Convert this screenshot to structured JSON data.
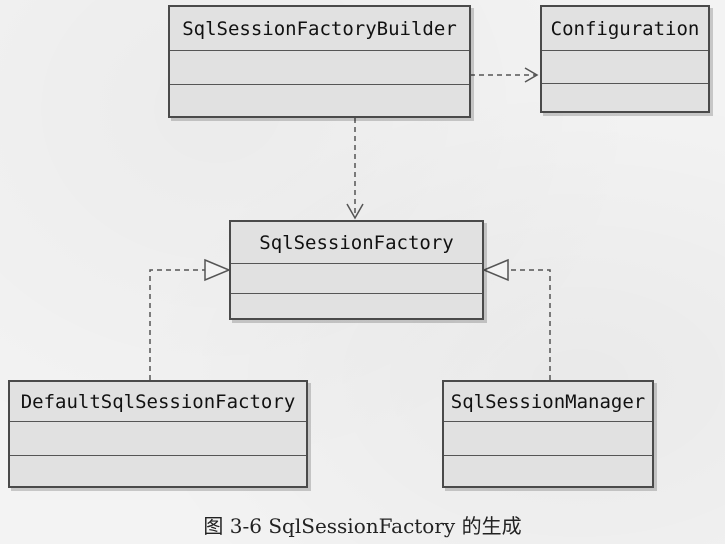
{
  "diagram": {
    "classes": {
      "sql_session_factory_builder": "SqlSessionFactoryBuilder",
      "configuration": "Configuration",
      "sql_session_factory": "SqlSessionFactory",
      "default_sql_session_factory": "DefaultSqlSessionFactory",
      "sql_session_manager": "SqlSessionManager"
    }
  },
  "caption": {
    "text": "图 3-6    SqlSessionFactory 的生成"
  }
}
